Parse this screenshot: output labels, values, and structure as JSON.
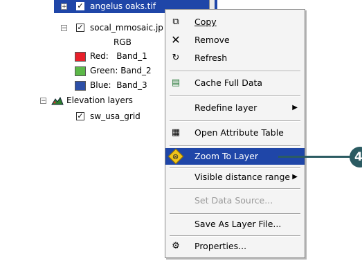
{
  "tree": {
    "selected_layer": "angelus oaks.tif",
    "layer2": "socal_mmosaic.jp",
    "rgb_label": "RGB",
    "bands": [
      {
        "label": "Red:   Band_1",
        "color": "#e8202a"
      },
      {
        "label": "Green: Band_2",
        "color": "#5cb848"
      },
      {
        "label": "Blue:  Band_3",
        "color": "#2d4fa7"
      }
    ],
    "group_label": "Elevation layers",
    "grid_layer": "sw_usa_grid",
    "expander_plus": "+",
    "expander_minus": "−",
    "check_mark": "✓"
  },
  "menu": {
    "items": [
      {
        "label": "Copy",
        "icon": "copy-icon",
        "glyph": "⧉"
      },
      {
        "label": "Remove",
        "icon": "remove-icon",
        "glyph": "✕"
      },
      {
        "label": "Refresh",
        "icon": "refresh-icon",
        "glyph": "↻"
      },
      {
        "label": "Cache Full Data",
        "icon": "cache-data-icon",
        "glyph": "▤"
      },
      {
        "label": "Redefine layer",
        "icon": "",
        "glyph": "",
        "submenu": true
      },
      {
        "label": "Open Attribute Table",
        "icon": "attribute-table-icon",
        "glyph": "▦"
      },
      {
        "label": "Zoom To Layer",
        "icon": "zoom-to-layer-icon",
        "glyph": "⊕",
        "highlighted": true
      },
      {
        "label": "Visible distance range",
        "icon": "",
        "glyph": "",
        "submenu": true
      },
      {
        "label": "Set Data Source...",
        "icon": "",
        "glyph": "",
        "disabled": true
      },
      {
        "label": "Save As Layer File...",
        "icon": "",
        "glyph": ""
      },
      {
        "label": "Properties...",
        "icon": "properties-icon",
        "glyph": "⚙"
      }
    ],
    "submenu_arrow": "▶"
  },
  "callout": {
    "number": "4",
    "color": "#2b5b62"
  },
  "colors": {
    "highlight": "#1f46a8",
    "menu_bg": "#f4f4f4"
  }
}
